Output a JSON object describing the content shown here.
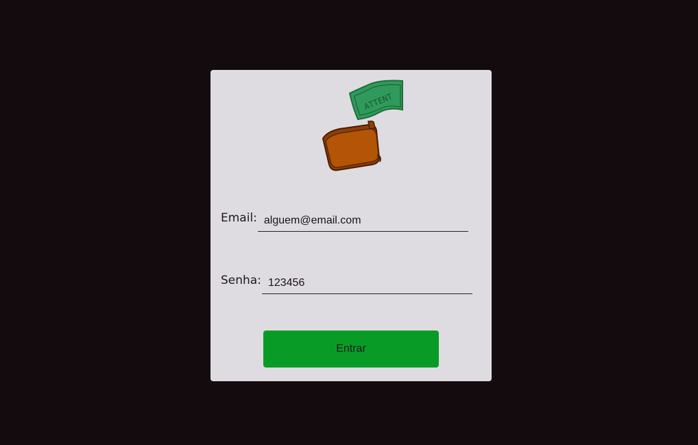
{
  "login": {
    "logo": {
      "icon": "wallet-money-icon",
      "banknote_text": "ATTENT"
    },
    "email": {
      "label": "Email:",
      "value": "alguem@email.com"
    },
    "password": {
      "label": "Senha:",
      "value": "123456"
    },
    "submit_label": "Entrar"
  },
  "colors": {
    "background": "#140b0e",
    "card": "#dfdce1",
    "button": "#089c27",
    "wallet": "#b35407",
    "banknote": "#2f9a5b"
  }
}
